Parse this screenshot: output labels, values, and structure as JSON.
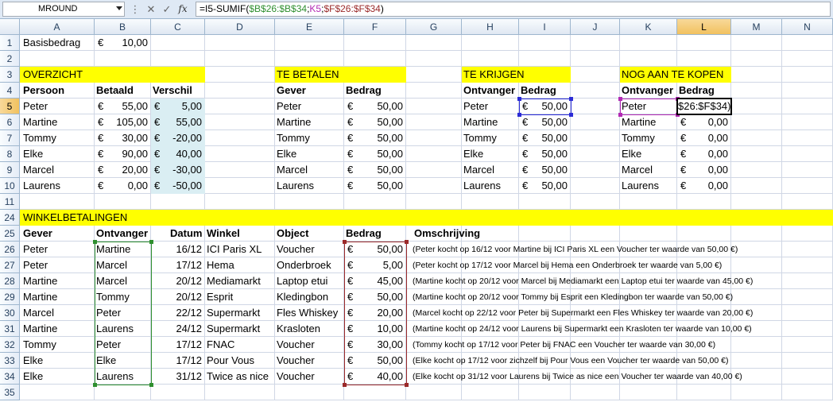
{
  "formula_bar": {
    "name_box": "MROUND",
    "fx": "fx",
    "formula_parts": [
      "=I5-SUMIF(",
      "$B$26:$B$34",
      ";",
      "K5",
      ";",
      "$F$26:$F$34",
      ")"
    ]
  },
  "columns": [
    "A",
    "B",
    "C",
    "D",
    "E",
    "F",
    "G",
    "H",
    "I",
    "J",
    "K",
    "L",
    "M",
    "N"
  ],
  "selected_column": "L",
  "rows": {
    "r1": {
      "num": "1",
      "label": "Basisbedrag",
      "eur": "€",
      "value": "10,00"
    },
    "r2": {
      "num": "2"
    },
    "r3": {
      "num": "3",
      "overzicht": "OVERZICHT",
      "te_betalen": "TE BETALEN",
      "te_krijgen": "TE KRIJGEN",
      "nog": "NOG AAN TE KOPEN"
    },
    "r4": {
      "num": "4",
      "persoon": "Persoon",
      "betaald": "Betaald",
      "verschil": "Verschil",
      "gever": "Gever",
      "bedrag1": "Bedrag",
      "ontvanger1": "Ontvanger",
      "bedrag2": "Bedrag",
      "ontvanger2": "Ontvanger",
      "bedrag3": "Bedrag"
    },
    "r11": {
      "num": "11"
    },
    "r24": {
      "num": "24",
      "title": "WINKELBETALINGEN"
    },
    "r25": {
      "num": "25",
      "gever": "Gever",
      "ontvanger": "Ontvanger",
      "datum": "Datum",
      "winkel": "Winkel",
      "object": "Object",
      "bedrag": "Bedrag",
      "omschrijving": "Omschrijving"
    },
    "r35": {
      "num": "35"
    }
  },
  "currency": "€",
  "summary_rows": [
    {
      "num": "5",
      "persoon": "Peter",
      "betaald": "55,00",
      "verschil": "5,00",
      "gever": "Peter",
      "bedrag1": "50,00",
      "ontv1": "Peter",
      "bedrag2": "50,00",
      "ontv2": "Peter",
      "bedrag3": "$26:$F$34)"
    },
    {
      "num": "6",
      "persoon": "Martine",
      "betaald": "105,00",
      "verschil": "55,00",
      "gever": "Martine",
      "bedrag1": "50,00",
      "ontv1": "Martine",
      "bedrag2": "50,00",
      "ontv2": "Martine",
      "bedrag3": "0,00"
    },
    {
      "num": "7",
      "persoon": "Tommy",
      "betaald": "30,00",
      "verschil": "-20,00",
      "gever": "Tommy",
      "bedrag1": "50,00",
      "ontv1": "Tommy",
      "bedrag2": "50,00",
      "ontv2": "Tommy",
      "bedrag3": "0,00"
    },
    {
      "num": "8",
      "persoon": "Elke",
      "betaald": "90,00",
      "verschil": "40,00",
      "gever": "Elke",
      "bedrag1": "50,00",
      "ontv1": "Elke",
      "bedrag2": "50,00",
      "ontv2": "Elke",
      "bedrag3": "0,00"
    },
    {
      "num": "9",
      "persoon": "Marcel",
      "betaald": "20,00",
      "verschil": "-30,00",
      "gever": "Marcel",
      "bedrag1": "50,00",
      "ontv1": "Marcel",
      "bedrag2": "50,00",
      "ontv2": "Marcel",
      "bedrag3": "0,00"
    },
    {
      "num": "10",
      "persoon": "Laurens",
      "betaald": "0,00",
      "verschil": "-50,00",
      "gever": "Laurens",
      "bedrag1": "50,00",
      "ontv1": "Laurens",
      "bedrag2": "50,00",
      "ontv2": "Laurens",
      "bedrag3": "0,00"
    }
  ],
  "payments": [
    {
      "num": "26",
      "gever": "Peter",
      "ontvanger": "Martine",
      "datum": "16/12",
      "winkel": "ICI Paris XL",
      "object": "Voucher",
      "bedrag": "50,00",
      "omschrijving": "(Peter kocht op 16/12 voor Martine bij ICI Paris XL een Voucher ter waarde van 50,00 €)"
    },
    {
      "num": "27",
      "gever": "Peter",
      "ontvanger": "Marcel",
      "datum": "17/12",
      "winkel": "Hema",
      "object": "Onderbroek",
      "bedrag": "5,00",
      "omschrijving": "(Peter kocht op 17/12 voor Marcel bij Hema een Onderbroek ter waarde van 5,00 €)"
    },
    {
      "num": "28",
      "gever": "Martine",
      "ontvanger": "Marcel",
      "datum": "20/12",
      "winkel": "Mediamarkt",
      "object": "Laptop etui",
      "bedrag": "45,00",
      "omschrijving": "(Martine kocht op 20/12 voor Marcel bij Mediamarkt een Laptop etui ter waarde van 45,00 €)"
    },
    {
      "num": "29",
      "gever": "Martine",
      "ontvanger": "Tommy",
      "datum": "20/12",
      "winkel": "Esprit",
      "object": "Kledingbon",
      "bedrag": "50,00",
      "omschrijving": "(Martine kocht op 20/12 voor Tommy bij Esprit een Kledingbon ter waarde van 50,00 €)"
    },
    {
      "num": "30",
      "gever": "Marcel",
      "ontvanger": "Peter",
      "datum": "22/12",
      "winkel": "Supermarkt",
      "object": "Fles Whiskey",
      "bedrag": "20,00",
      "omschrijving": "(Marcel kocht op 22/12 voor Peter bij Supermarkt een Fles Whiskey ter waarde van 20,00 €)"
    },
    {
      "num": "31",
      "gever": "Martine",
      "ontvanger": "Laurens",
      "datum": "24/12",
      "winkel": "Supermarkt",
      "object": "Krasloten",
      "bedrag": "10,00",
      "omschrijving": "(Martine kocht op 24/12 voor Laurens bij Supermarkt een Krasloten ter waarde van 10,00 €)"
    },
    {
      "num": "32",
      "gever": "Tommy",
      "ontvanger": "Peter",
      "datum": "17/12",
      "winkel": "FNAC",
      "object": "Voucher",
      "bedrag": "30,00",
      "omschrijving": "(Tommy kocht op 17/12 voor Peter bij FNAC een Voucher ter waarde van 30,00 €)"
    },
    {
      "num": "33",
      "gever": "Elke",
      "ontvanger": "Elke",
      "datum": "17/12",
      "winkel": "Pour Vous",
      "object": "Voucher",
      "bedrag": "50,00",
      "omschrijving": "(Elke kocht op 17/12 voor zichzelf bij Pour Vous een Voucher ter waarde van 50,00 €)"
    },
    {
      "num": "34",
      "gever": "Elke",
      "ontvanger": "Laurens",
      "datum": "31/12",
      "winkel": "Twice as nice",
      "object": "Voucher",
      "bedrag": "40,00",
      "omschrijving": "(Elke kocht op 31/12 voor Laurens bij Twice as nice een Voucher ter waarde van 40,00 €)"
    }
  ],
  "colors": {
    "highlight_yellow": "#ffff00",
    "verschil_fill": "#daeef3",
    "ref_green": "#2f8f2f",
    "ref_blue": "#2c2cd6",
    "ref_pink": "#b32ab3",
    "ref_maroon": "#9b2a2a"
  }
}
